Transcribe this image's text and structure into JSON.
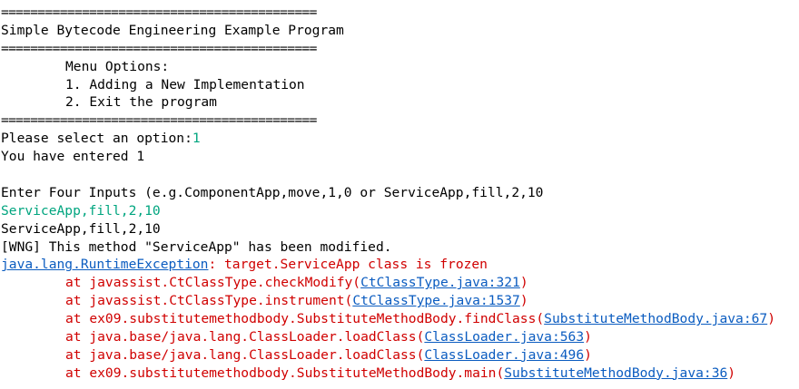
{
  "console": {
    "separator": "===========================================",
    "header_title": "Simple Bytecode Engineering Example Program",
    "menu_title": "Menu Options:",
    "menu_option_1": "1. Adding a New Implementation",
    "menu_option_2": "2. Exit the program",
    "prompt_text": "Please select an option:",
    "prompt_input": "1",
    "entered_message": "You have entered 1",
    "four_inputs_prompt": "Enter Four Inputs (e.g.ComponentApp,move,1,0 or ServiceApp,fill,2,10",
    "user_input_echo": "ServiceApp,fill,2,10",
    "program_echo": "ServiceApp,fill,2,10",
    "warning_message": "[WNG] This method \"ServiceApp\" has been modified.",
    "exception_class": "java.lang.RuntimeException",
    "exception_message": ": target.ServiceApp class is frozen",
    "stack_frames": [
      {
        "prefix": "at javassist.CtClassType.checkModify(",
        "link": "CtClassType.java:321",
        "suffix": ")"
      },
      {
        "prefix": "at javassist.CtClassType.instrument(",
        "link": "CtClassType.java:1537",
        "suffix": ")"
      },
      {
        "prefix": "at ex09.substitutemethodbody.SubstituteMethodBody.findClass(",
        "link": "SubstituteMethodBody.java:67",
        "suffix": ")"
      },
      {
        "prefix": "at java.base/java.lang.ClassLoader.loadClass(",
        "link": "ClassLoader.java:563",
        "suffix": ")"
      },
      {
        "prefix": "at java.base/java.lang.ClassLoader.loadClass(",
        "link": "ClassLoader.java:496",
        "suffix": ")"
      },
      {
        "prefix": "at ex09.substitutemethodbody.SubstituteMethodBody.main(",
        "link": "SubstituteMethodBody.java:36",
        "suffix": ")"
      }
    ]
  },
  "colors": {
    "text": "#000000",
    "input_green": "#00a57f",
    "error_red": "#d00000",
    "link_blue": "#0b5cc0",
    "background": "#ffffff"
  }
}
